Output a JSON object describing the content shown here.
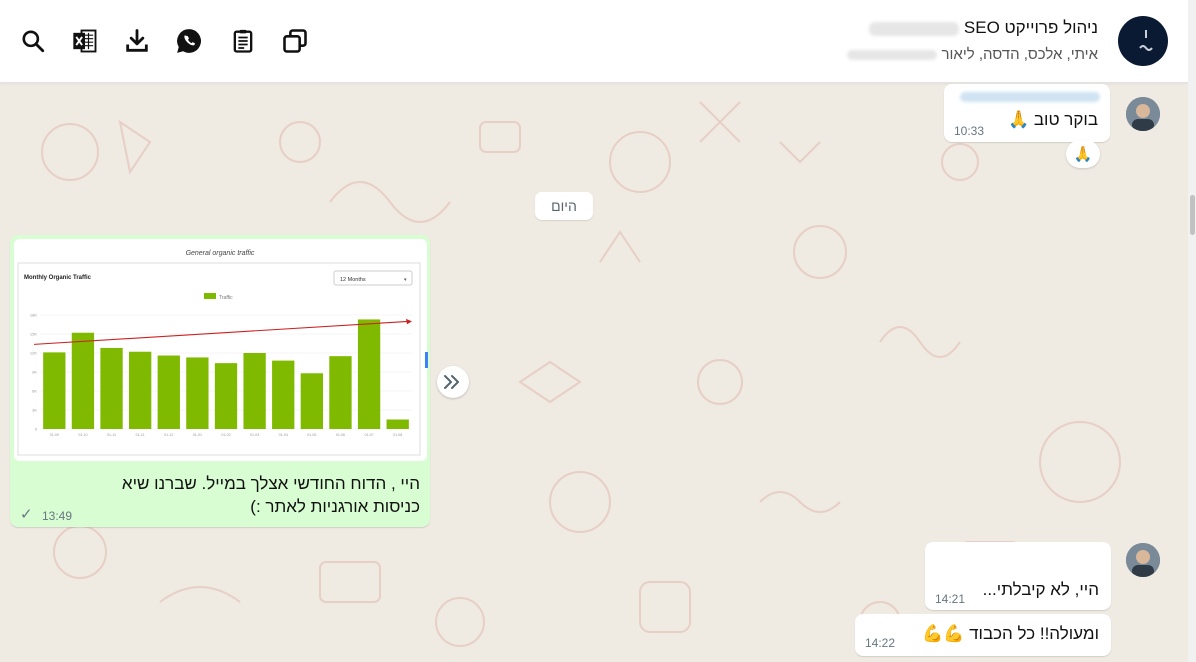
{
  "header": {
    "group_title": "ניהול פרוייקט SEO",
    "group_members": "איתי, אלכס, הדסה, ליאור",
    "icons": [
      "search-icon",
      "excel-export-icon",
      "download-icon",
      "whatsapp-icon",
      "clipboard-icon",
      "copy-windows-icon"
    ]
  },
  "messages": [
    {
      "id": "m1",
      "direction": "incoming",
      "text": "בוקר טוב 🙏",
      "time": "10:33",
      "reaction": "🙏"
    },
    {
      "id": "m2",
      "direction": "outgoing",
      "line1": "היי , הדוח החודשי אצלך במייל. שברנו שיא",
      "line2": "כניסות אורגניות לאתר :)",
      "time": "13:49",
      "status": "✓"
    },
    {
      "id": "m3",
      "direction": "incoming",
      "text": "היי, לא קיבלתי...",
      "time": "14:21"
    },
    {
      "id": "m4",
      "direction": "incoming",
      "text": "ומעולה!! כל הכבוד 💪💪",
      "time": "14:22"
    }
  ],
  "date_divider": "היום",
  "chart_data": {
    "type": "bar",
    "title": "General organic traffic",
    "subtitle": "Monthly Organic Traffic",
    "dropdown": "12 Months",
    "legend": [
      "Traffic"
    ],
    "categories": [
      "01-09",
      "01-10",
      "01-11",
      "01-11",
      "01-12",
      "01-01",
      "01-02",
      "01-03",
      "01-04",
      "01-05",
      "01-06",
      "01-07",
      "01-08"
    ],
    "values": [
      12.1,
      15.2,
      12.8,
      12.2,
      11.6,
      11.3,
      10.4,
      12.0,
      10.8,
      8.8,
      11.5,
      17.3,
      1.5
    ],
    "y_ticks": [
      "0",
      "3K",
      "6K",
      "9K",
      "12K",
      "15K",
      "18K"
    ],
    "ylim": [
      0,
      18
    ],
    "series_color": "#7fba00",
    "trend_color": "#cc2222"
  }
}
